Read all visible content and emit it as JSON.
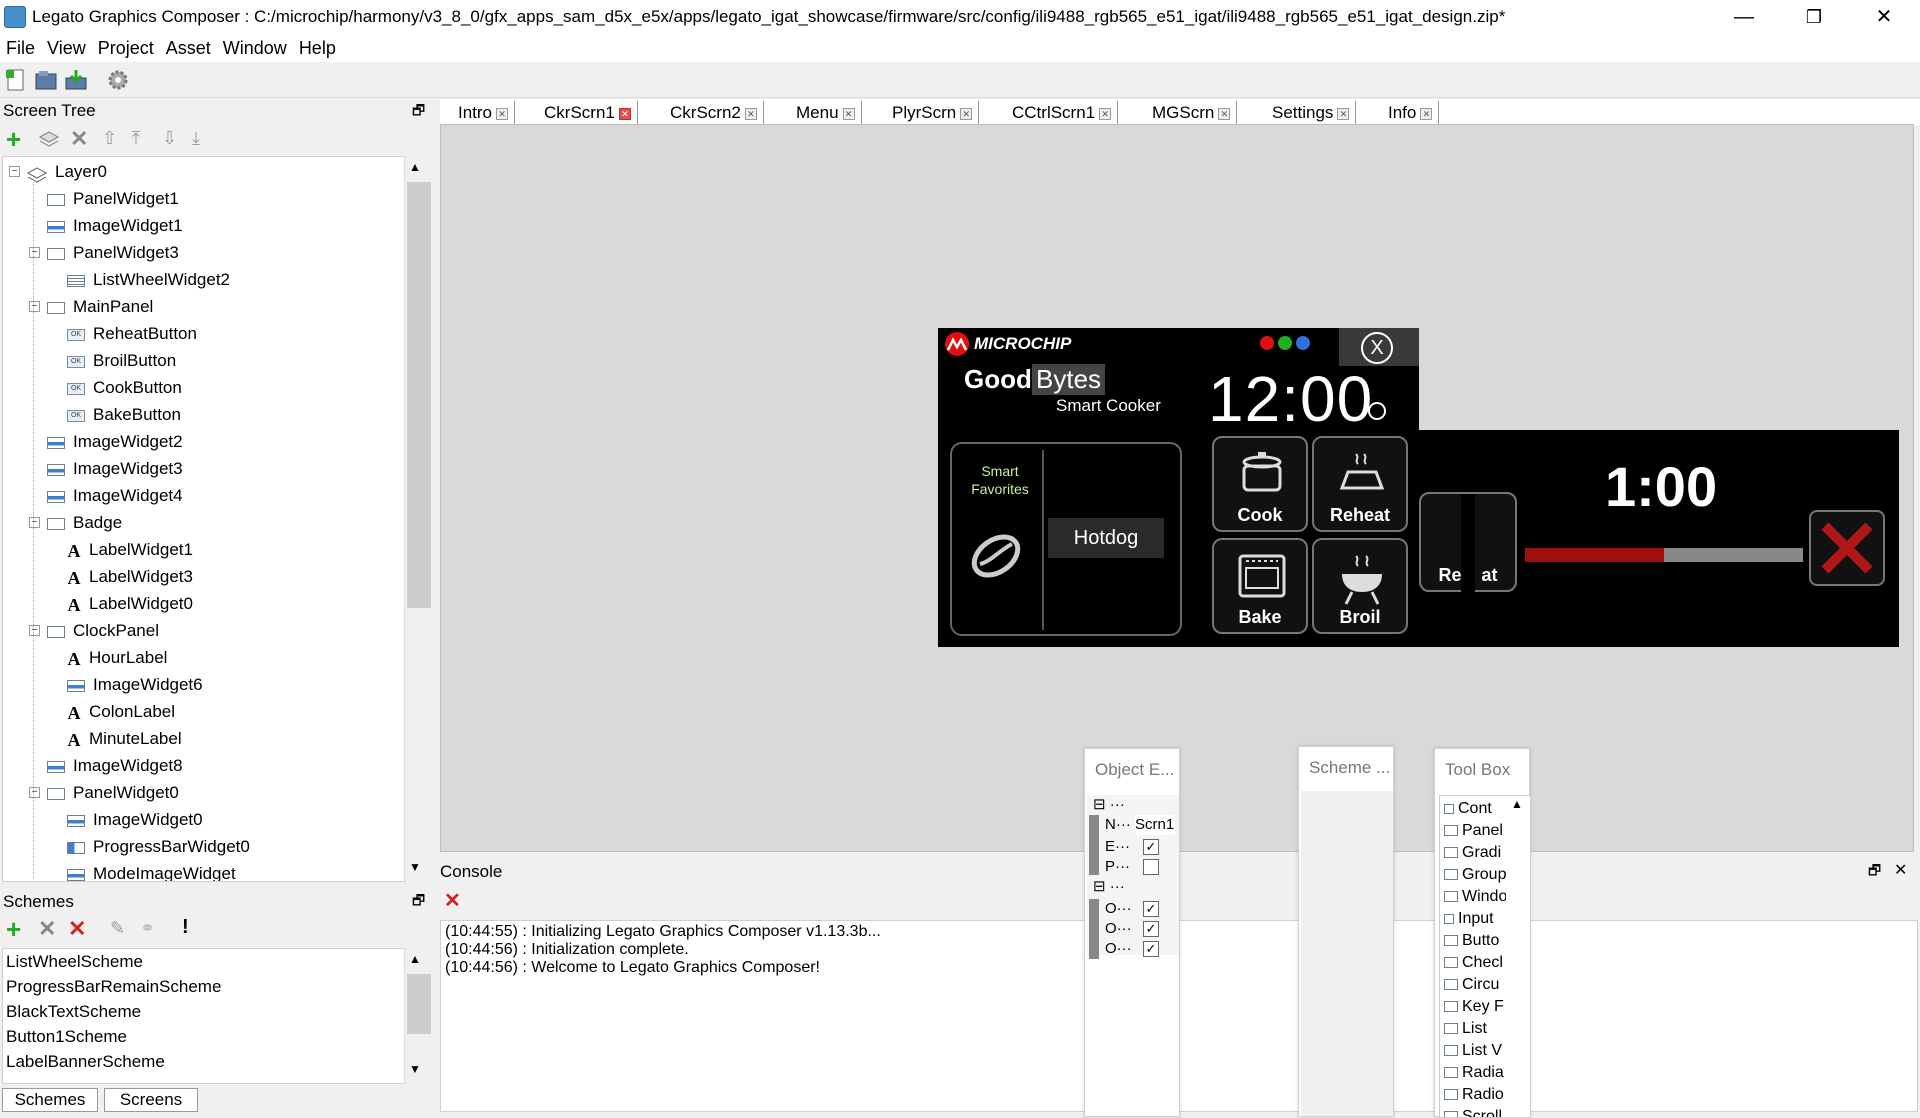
{
  "window": {
    "title": "Legato Graphics Composer : C:/microchip/harmony/v3_8_0/gfx_apps_sam_d5x_e5x/apps/legato_igat_showcase/firmware/src/config/ili9488_rgb565_e51_igat/ili9488_rgb565_e51_igat_design.zip*",
    "minimize": "—",
    "restore": "❐",
    "close": "✕"
  },
  "menu": [
    "File",
    "View",
    "Project",
    "Asset",
    "Window",
    "Help"
  ],
  "screen_tree": {
    "title": "Screen Tree",
    "nodes": [
      {
        "label": "Layer0",
        "icon": "layer-icon",
        "level": 0,
        "expander": "⊟"
      },
      {
        "label": "PanelWidget1",
        "icon": "panel-icon",
        "level": 1
      },
      {
        "label": "ImageWidget1",
        "icon": "image-icon",
        "level": 1
      },
      {
        "label": "PanelWidget3",
        "icon": "panel-icon",
        "level": 1,
        "expander": "⊟"
      },
      {
        "label": "ListWheelWidget2",
        "icon": "list-icon",
        "level": 2
      },
      {
        "label": "MainPanel",
        "icon": "panel-icon",
        "level": 1,
        "expander": "⊟"
      },
      {
        "label": "ReheatButton",
        "icon": "button-icon",
        "level": 2
      },
      {
        "label": "BroilButton",
        "icon": "button-icon",
        "level": 2
      },
      {
        "label": "CookButton",
        "icon": "button-icon",
        "level": 2
      },
      {
        "label": "BakeButton",
        "icon": "button-icon",
        "level": 2
      },
      {
        "label": "ImageWidget2",
        "icon": "image-icon",
        "level": 1
      },
      {
        "label": "ImageWidget3",
        "icon": "image-icon",
        "level": 1
      },
      {
        "label": "ImageWidget4",
        "icon": "image-icon",
        "level": 1
      },
      {
        "label": "Badge",
        "icon": "panel-icon",
        "level": 1,
        "expander": "⊟"
      },
      {
        "label": "LabelWidget1",
        "icon": "label-icon",
        "level": 2
      },
      {
        "label": "LabelWidget3",
        "icon": "label-icon",
        "level": 2
      },
      {
        "label": "LabelWidget0",
        "icon": "label-icon",
        "level": 2
      },
      {
        "label": "ClockPanel",
        "icon": "panel-icon",
        "level": 1,
        "expander": "⊟"
      },
      {
        "label": "HourLabel",
        "icon": "label-icon",
        "level": 2
      },
      {
        "label": "ImageWidget6",
        "icon": "image-icon",
        "level": 2
      },
      {
        "label": "ColonLabel",
        "icon": "label-icon",
        "level": 2
      },
      {
        "label": "MinuteLabel",
        "icon": "label-icon",
        "level": 2
      },
      {
        "label": "ImageWidget8",
        "icon": "image-icon",
        "level": 1
      },
      {
        "label": "PanelWidget0",
        "icon": "panel-icon",
        "level": 1,
        "expander": "⊟"
      },
      {
        "label": "ImageWidget0",
        "icon": "image-icon",
        "level": 2
      },
      {
        "label": "ProgressBarWidget0",
        "icon": "progress-icon",
        "level": 2
      },
      {
        "label": "ModeImageWidget",
        "icon": "image-icon",
        "level": 2
      }
    ]
  },
  "tabs": [
    {
      "label": "Intro"
    },
    {
      "label": "CkrScrn1",
      "active": true
    },
    {
      "label": "CkrScrn2"
    },
    {
      "label": "Menu"
    },
    {
      "label": "PlyrScrn"
    },
    {
      "label": "CCtrlScrn1"
    },
    {
      "label": "MGScrn"
    },
    {
      "label": "Settings"
    },
    {
      "label": "Info"
    }
  ],
  "device": {
    "brand": "MICROCHIP",
    "title_good": "Good",
    "title_bytes": "Bytes",
    "subtitle": "Smart Cooker",
    "close_glyph": "X",
    "clock_hour": "12",
    "clock_colon": ":",
    "clock_minute": "00",
    "smart_favorites": "Smart\nFavorites",
    "favorite_item": "Hotdog",
    "buttons": {
      "cook": "Cook",
      "reheat": "Reheat",
      "bake": "Bake",
      "broil": "Broil"
    },
    "reheat_partial": "Re    at",
    "timer": "1:00",
    "progress": 0.5,
    "dot_colors": [
      "#e01010",
      "#20b020",
      "#3070e0"
    ],
    "progress_color": "#a01010",
    "progress_bg": "#888888"
  },
  "schemes": {
    "title": "Schemes",
    "items": [
      "ListWheelScheme",
      "ProgressBarRemainScheme",
      "BlackTextScheme",
      "Button1Scheme",
      "LabelBannerScheme"
    ],
    "bottom_tabs": [
      "Schemes",
      "Screens"
    ]
  },
  "console": {
    "title": "Console",
    "lines": [
      "(10:44:55) : Initializing Legato Graphics Composer v1.13.3b...",
      "(10:44:56) : Initialization complete.",
      "(10:44:56) : Welcome to Legato Graphics Composer!"
    ]
  },
  "object_editor": {
    "title": "Object E...",
    "group_glyph": "⊟ ···",
    "rows": [
      {
        "key": "N···",
        "val": "Scrn1"
      },
      {
        "key": "E···",
        "checked": true
      },
      {
        "key": "P···",
        "checked": false
      }
    ],
    "rows2": [
      {
        "key": "O···",
        "checked": true
      },
      {
        "key": "O···",
        "checked": true
      },
      {
        "key": "O···",
        "checked": true
      }
    ]
  },
  "scheme_editor": {
    "title": "Scheme ..."
  },
  "toolbox": {
    "title": "Tool Box",
    "items": [
      {
        "label": "Cont",
        "group": true
      },
      {
        "label": "Panel"
      },
      {
        "label": "Gradi"
      },
      {
        "label": "Group"
      },
      {
        "label": "Windo"
      },
      {
        "label": "Input",
        "group": true
      },
      {
        "label": "Butto"
      },
      {
        "label": "Checl"
      },
      {
        "label": "Circu"
      },
      {
        "label": "Key F"
      },
      {
        "label": "List"
      },
      {
        "label": "List V"
      },
      {
        "label": "Radia"
      },
      {
        "label": "Radio"
      },
      {
        "label": "Scroll"
      }
    ]
  },
  "checkmark": "✓",
  "undock_glyph": "🗗",
  "close_glyph": "✕"
}
